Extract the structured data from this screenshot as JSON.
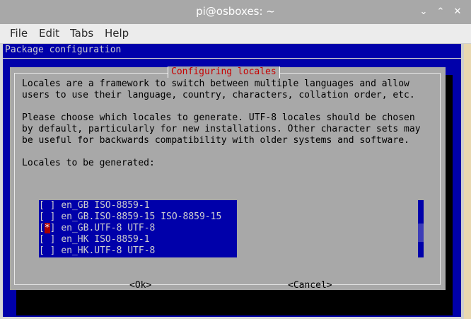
{
  "window": {
    "title": "pi@osboxes: ~",
    "btn_min": "⌄",
    "btn_max": "⌃",
    "btn_close": "✕"
  },
  "menubar": {
    "items": [
      "File",
      "Edit",
      "Tabs",
      "Help"
    ]
  },
  "terminal": {
    "backtitle": "Package configuration",
    "dialog": {
      "title": "Configuring locales",
      "paragraph1": [
        "Locales are a framework to switch between multiple languages and allow",
        "users to use their language, country, characters, collation order, etc."
      ],
      "paragraph2": [
        "Please choose which locales to generate. UTF-8 locales should be chosen",
        "by default, particularly for new installations. Other character sets may",
        "be useful for backwards compatibility with older systems and software."
      ],
      "list_label": "Locales to be generated:",
      "locales": [
        {
          "mark": " ",
          "label": "en_GB ISO-8859-1"
        },
        {
          "mark": " ",
          "label": "en_GB.ISO-8859-15 ISO-8859-15"
        },
        {
          "mark": "*",
          "label": "en_GB.UTF-8 UTF-8"
        },
        {
          "mark": " ",
          "label": "en_HK ISO-8859-1"
        },
        {
          "mark": " ",
          "label": "en_HK.UTF-8 UTF-8"
        }
      ],
      "ok_label": "<Ok>",
      "cancel_label": "<Cancel>"
    }
  },
  "colors": {
    "terminal_bg": "#0000aa",
    "dialog_bg": "#a8a8a8",
    "dialog_title": "#c80000",
    "selected_mark_bg": "#aa0000"
  }
}
